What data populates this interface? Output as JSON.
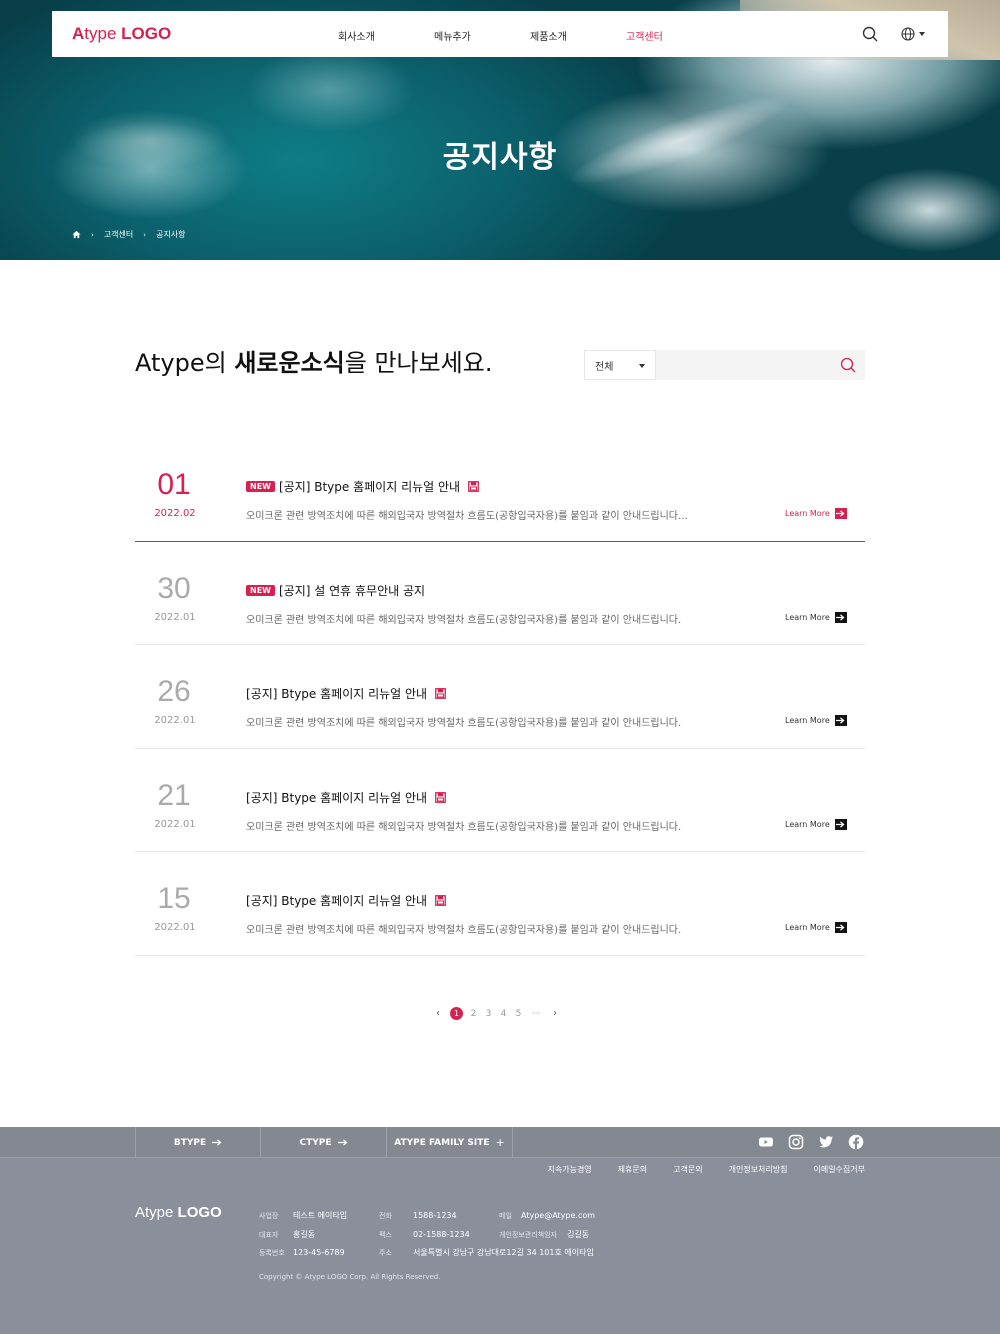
{
  "header": {
    "logo_prefix": "A",
    "logo_mid": "type ",
    "logo_bold": "LOGO",
    "nav": [
      {
        "label": "회사소개"
      },
      {
        "label": "메뉴추가"
      },
      {
        "label": "제품소개"
      },
      {
        "label": "고객센터"
      }
    ],
    "active_nav_index": 3
  },
  "hero": {
    "title": "공지사항",
    "breadcrumb": [
      "고객센터",
      "공지사항"
    ]
  },
  "main": {
    "headline_prefix": "Atype의 ",
    "headline_bold": "새로운소식",
    "headline_suffix": "을 만나보세요.",
    "search": {
      "select_value": "전체",
      "placeholder": ""
    }
  },
  "notices": [
    {
      "day": "01",
      "ym": "2022.02",
      "new": true,
      "title": "[공지] Btype 홈페이지 리뉴얼 안내",
      "attachment": true,
      "desc": "오미크론 관련 방역조치에 따른 해외입국자 방역절차 흐름도(공항입국자용)를 붙임과 같이 안내드립니다…",
      "more": "Learn More"
    },
    {
      "day": "30",
      "ym": "2022.01",
      "new": true,
      "title": "[공지] 설 연휴 휴무안내 공지",
      "attachment": false,
      "desc": "오미크론 관련 방역조치에 따른 해외입국자 방역절차 흐름도(공항입국자용)를 붙임과 같이 안내드립니다.",
      "more": "Learn More"
    },
    {
      "day": "26",
      "ym": "2022.01",
      "new": false,
      "title": "[공지] Btype 홈페이지 리뉴얼 안내",
      "attachment": true,
      "desc": "오미크론 관련 방역조치에 따른 해외입국자 방역절차 흐름도(공항입국자용)를 붙임과 같이 안내드립니다.",
      "more": "Learn More"
    },
    {
      "day": "21",
      "ym": "2022.01",
      "new": false,
      "title": "[공지] Btype 홈페이지 리뉴얼 안내",
      "attachment": true,
      "desc": "오미크론 관련 방역조치에 따른 해외입국자 방역절차 흐름도(공항입국자용)를 붙임과 같이 안내드립니다.",
      "more": "Learn More"
    },
    {
      "day": "15",
      "ym": "2022.01",
      "new": false,
      "title": "[공지] Btype 홈페이지 리뉴얼 안내",
      "attachment": true,
      "desc": "오미크론 관련 방역조치에 따른 해외입국자 방역절차 흐름도(공항입국자용)를 붙임과 같이 안내드립니다.",
      "more": "Learn More"
    }
  ],
  "badge_new": "NEW",
  "pagination": {
    "pages": [
      "1",
      "2",
      "3",
      "4",
      "5"
    ],
    "ellipsis": "···",
    "current": "1"
  },
  "footer": {
    "family": [
      {
        "label": "BTYPE",
        "icon": "arrow-right"
      },
      {
        "label": "CTYPE",
        "icon": "arrow-right"
      },
      {
        "label": "ATYPE FAMILY SITE",
        "icon": "plus"
      }
    ],
    "links": [
      "지속가능경영",
      "제휴문의",
      "고객문의",
      "개인정보처리방침",
      "이메일수집거부"
    ],
    "logo_light": "Atype ",
    "logo_bold": "LOGO",
    "info": {
      "c1": [
        {
          "k": "사업장",
          "v": "테스트 에이타입"
        },
        {
          "k": "대표자",
          "v": "홍길동"
        },
        {
          "k": "등록번호",
          "v": "123-45-6789"
        }
      ],
      "c2": [
        {
          "k": "전화",
          "v": "1588-1234"
        },
        {
          "k": "팩스",
          "v": "02-1588-1234"
        },
        {
          "k": "주소",
          "v": "서울특별시 강남구 강남대로12길 34 101호 에이타입"
        }
      ],
      "c3": [
        {
          "k": "메일",
          "v": "Atype@Atype.com"
        },
        {
          "k": "개인정보관리책임자",
          "v": "김길동"
        }
      ]
    },
    "copyright": "Copyright © Atype LOGO Corp. All Rights Reserved."
  },
  "colors": {
    "accent": "#d6204f",
    "footer_bg": "#8b8f9c"
  }
}
